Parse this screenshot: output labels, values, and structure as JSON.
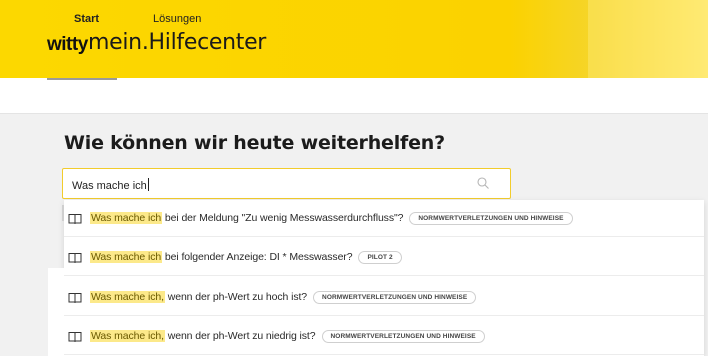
{
  "header": {
    "logo": "witty",
    "title": "mein.Hilfecenter"
  },
  "nav": {
    "tabs": [
      {
        "label": "Start",
        "active": true
      },
      {
        "label": "Lösungen",
        "active": false
      }
    ]
  },
  "main": {
    "headline": "Wie können wir heute weiterhelfen?",
    "search": {
      "value": "Was mache ich",
      "icon": "search-icon"
    },
    "results": [
      {
        "highlight": "Was mache ich",
        "rest": " bei der Meldung \"Zu wenig Messwasserdurchfluss\"?",
        "badge": "NORMWERTVERLETZUNGEN UND HINWEISE",
        "icon": "book-icon"
      },
      {
        "highlight": "Was mache ich",
        "rest": " bei folgender Anzeige: DI * Messwasser?",
        "badge": "PILOT 2",
        "icon": "book-icon"
      },
      {
        "highlight": "Was mache ich,",
        "rest": " wenn der ph-Wert zu hoch ist?",
        "badge": "NORMWERTVERLETZUNGEN UND HINWEISE",
        "icon": "book-icon"
      },
      {
        "highlight": "Was mache ich,",
        "rest": " wenn der ph-Wert zu niedrig ist?",
        "badge": "NORMWERTVERLETZUNGEN UND HINWEISE",
        "icon": "book-icon"
      }
    ]
  },
  "colors": {
    "brand_yellow": "#fcd800",
    "highlight": "#fce98a",
    "search_border": "#f2cc2c"
  }
}
